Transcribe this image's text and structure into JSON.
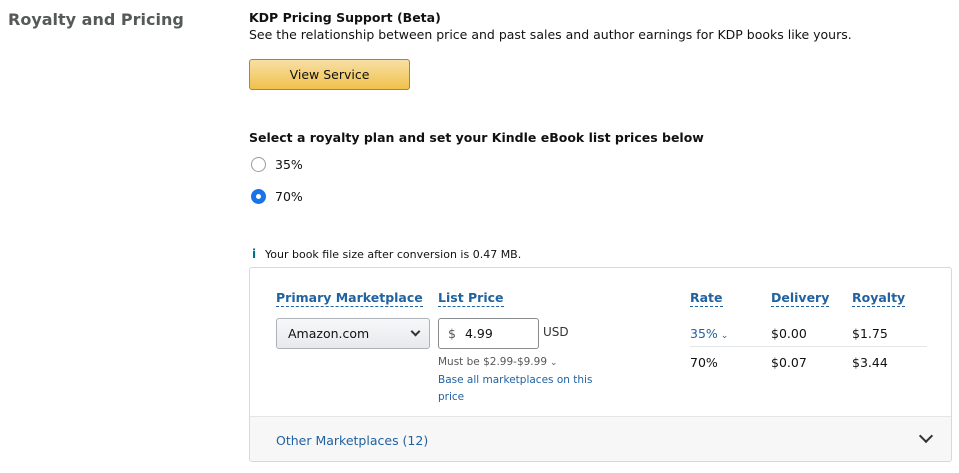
{
  "section": {
    "title": "Royalty and Pricing"
  },
  "kdp_support": {
    "title": "KDP Pricing Support (Beta)",
    "description": "See the relationship between price and past sales and author earnings for KDP books like yours.",
    "button_label": "View Service"
  },
  "royalty_plan": {
    "heading": "Select a royalty plan and set your Kindle eBook list prices below",
    "options": [
      {
        "label": "35%",
        "selected": false
      },
      {
        "label": "70%",
        "selected": true
      }
    ]
  },
  "info": {
    "icon": "info-icon",
    "glyph": "i",
    "text": "Your book file size after conversion is 0.47 MB."
  },
  "pricing_table": {
    "headers": {
      "marketplace": "Primary Marketplace",
      "list_price": "List Price",
      "rate": "Rate",
      "delivery": "Delivery",
      "royalty": "Royalty"
    },
    "marketplace_selected": "Amazon.com",
    "currency_symbol": "$",
    "price_value": "4.99",
    "currency_code": "USD",
    "price_range_hint": "Must be $2.99-$9.99",
    "base_all_link": "Base all marketplaces on this price",
    "rows": [
      {
        "rate": "35%",
        "delivery": "$0.00",
        "royalty": "$1.75"
      },
      {
        "rate": "70%",
        "delivery": "$0.07",
        "royalty": "$3.44"
      }
    ],
    "other_marketplaces": "Other Marketplaces (12)"
  },
  "colors": {
    "link": "#2162a1",
    "button_yellow": "#f0c14b",
    "radio_selected": "#1a73e8"
  }
}
